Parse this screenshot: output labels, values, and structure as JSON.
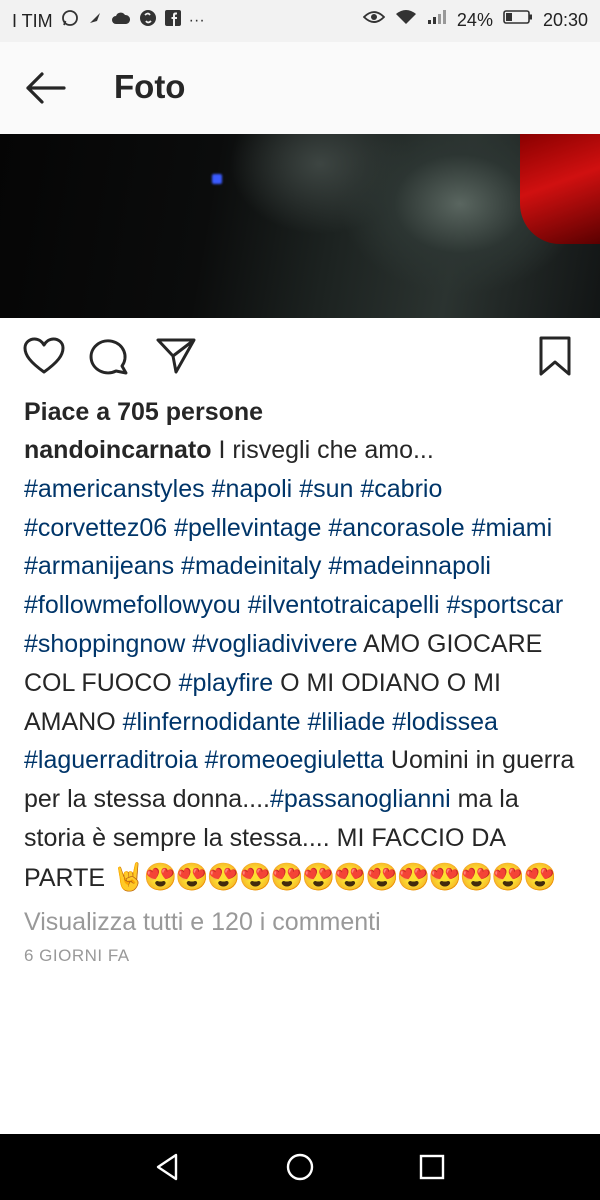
{
  "status_bar": {
    "carrier": "I TIM",
    "battery": "24%",
    "time": "20:30",
    "left_icons": [
      "whatsapp-icon",
      "notification-icon",
      "cloud-icon",
      "shazam-icon",
      "facebook-icon",
      "more-icon"
    ],
    "right_icons": [
      "eye-icon",
      "wifi-icon",
      "signal-icon",
      "battery-icon"
    ]
  },
  "header": {
    "title": "Foto"
  },
  "post": {
    "likes": "Piace a 705 persone",
    "username": "nandoincarnato",
    "caption_segments": [
      {
        "text": " I risvegli che amo... ",
        "type": "text"
      },
      {
        "text": "#americanstyles",
        "type": "tag"
      },
      {
        "text": " ",
        "type": "text"
      },
      {
        "text": "#napoli",
        "type": "tag"
      },
      {
        "text": " ",
        "type": "text"
      },
      {
        "text": "#sun",
        "type": "tag"
      },
      {
        "text": " ",
        "type": "text"
      },
      {
        "text": "#cabrio",
        "type": "tag"
      },
      {
        "text": " ",
        "type": "text"
      },
      {
        "text": "#corvettez06",
        "type": "tag"
      },
      {
        "text": " ",
        "type": "text"
      },
      {
        "text": "#pellevintage",
        "type": "tag"
      },
      {
        "text": " ",
        "type": "text"
      },
      {
        "text": "#ancorasole",
        "type": "tag"
      },
      {
        "text": " ",
        "type": "text"
      },
      {
        "text": "#miami",
        "type": "tag"
      },
      {
        "text": " ",
        "type": "text"
      },
      {
        "text": "#armanijeans",
        "type": "tag"
      },
      {
        "text": " ",
        "type": "text"
      },
      {
        "text": "#madeinitaly",
        "type": "tag"
      },
      {
        "text": " ",
        "type": "text"
      },
      {
        "text": "#madeinnapoli",
        "type": "tag"
      },
      {
        "text": " ",
        "type": "text"
      },
      {
        "text": "#followmefollowyou",
        "type": "tag"
      },
      {
        "text": " ",
        "type": "text"
      },
      {
        "text": "#ilventotraicapelli",
        "type": "tag"
      },
      {
        "text": " ",
        "type": "text"
      },
      {
        "text": "#sportscar",
        "type": "tag"
      },
      {
        "text": " ",
        "type": "text"
      },
      {
        "text": "#shoppingnow",
        "type": "tag"
      },
      {
        "text": " ",
        "type": "text"
      },
      {
        "text": "#vogliadivivere",
        "type": "tag"
      },
      {
        "text": " AMO GIOCARE COL FUOCO ",
        "type": "text"
      },
      {
        "text": "#playfire",
        "type": "tag"
      },
      {
        "text": " O MI ODIANO O MI AMANO ",
        "type": "text"
      },
      {
        "text": "#linfernodidante",
        "type": "tag"
      },
      {
        "text": " ",
        "type": "text"
      },
      {
        "text": "#liliade",
        "type": "tag"
      },
      {
        "text": " ",
        "type": "text"
      },
      {
        "text": "#lodissea",
        "type": "tag"
      },
      {
        "text": " ",
        "type": "text"
      },
      {
        "text": "#laguerraditroia",
        "type": "tag"
      },
      {
        "text": " ",
        "type": "text"
      },
      {
        "text": "#romeoegiuletta",
        "type": "tag"
      },
      {
        "text": " Uomini in guerra per la stessa donna....",
        "type": "text"
      },
      {
        "text": "#passanoglianni",
        "type": "tag"
      },
      {
        "text": " ma la storia è sempre la stessa.... MI FACCIO DA PARTE ",
        "type": "text"
      }
    ],
    "emoji_line": "🤘😍😍😍😍😍😍😍😍😍😍😍😍😍",
    "view_comments": "Visualizza tutti e 120 i commenti",
    "time_ago": "6 GIORNI FA"
  },
  "colors": {
    "hashtag": "#003569",
    "text": "#262626",
    "muted": "#999999",
    "status_bg": "#f2f2f2",
    "header_bg": "#fafafa"
  },
  "nav_bar": {
    "icons": [
      "back-triangle-icon",
      "home-circle-icon",
      "recents-square-icon"
    ]
  }
}
